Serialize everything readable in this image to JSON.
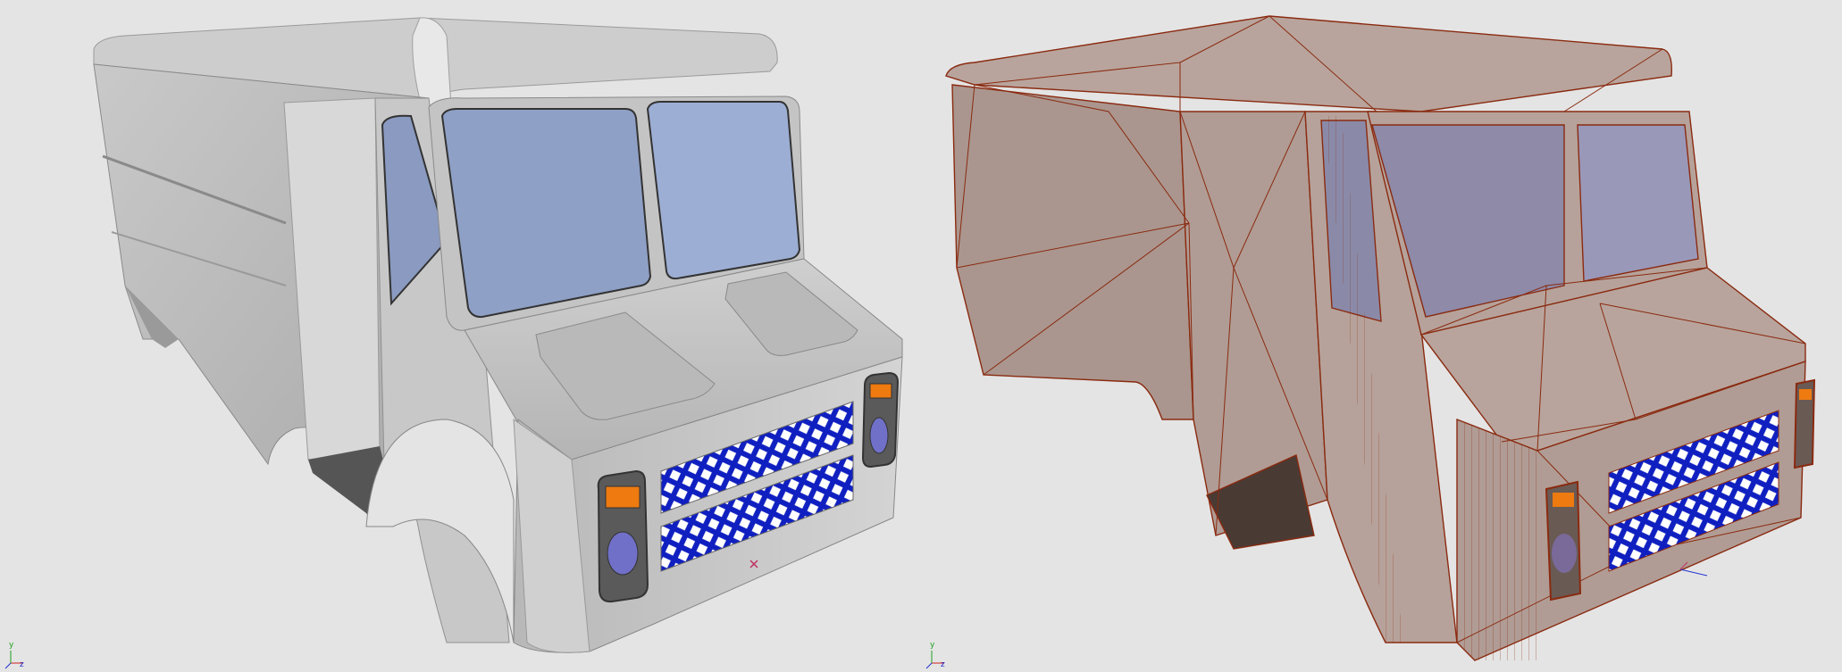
{
  "viewports": [
    {
      "id": "shaded",
      "render_mode": "shaded"
    },
    {
      "id": "wireframe",
      "render_mode": "shaded-with-mesh-edges"
    }
  ],
  "axes": {
    "y_label": "y",
    "z_label": "z"
  },
  "colors": {
    "background": "#e4e4e4",
    "body_gray": "#bdbdbd",
    "glass_blue": "#9aaad0",
    "grille_blue": "#1020c0",
    "indicator_orange": "#ee7a10",
    "headlight_purple": "#7070c8",
    "mesh_edge": "#8a2a10",
    "mesh_body": "#b8a49c",
    "axis_x": "#d02020",
    "axis_y": "#20a020",
    "axis_z": "#2030d0"
  }
}
